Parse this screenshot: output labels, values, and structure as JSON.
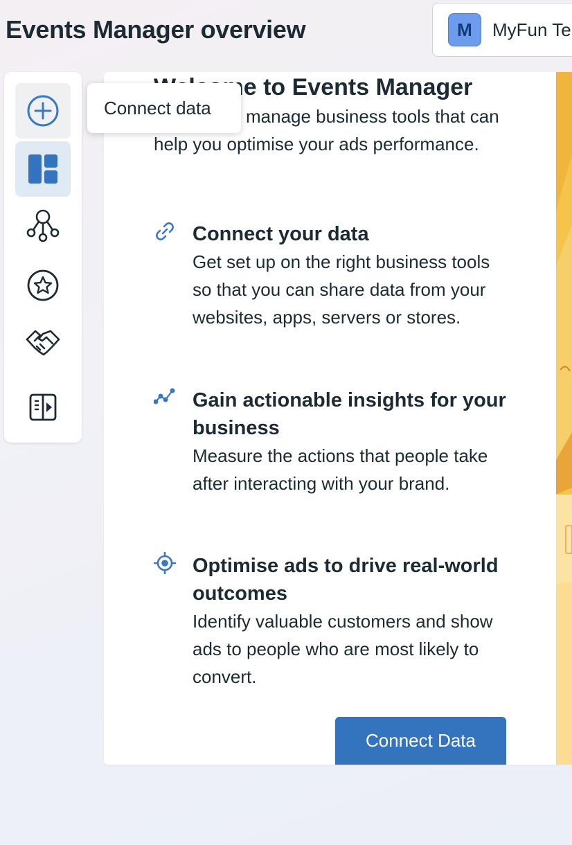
{
  "header": {
    "title": "Events Manager overview",
    "account": {
      "avatar_letter": "M",
      "name": "MyFun Te"
    }
  },
  "sidebar": {
    "items": [
      {
        "icon": "plus-circle-icon",
        "state": "hover"
      },
      {
        "icon": "dashboard-icon",
        "state": "active"
      },
      {
        "icon": "data-sources-icon",
        "state": "default"
      },
      {
        "icon": "star-badge-icon",
        "state": "default"
      },
      {
        "icon": "handshake-icon",
        "state": "default"
      },
      {
        "icon": "sidebar-toggle-icon",
        "state": "default"
      }
    ],
    "tooltip": "Connect data"
  },
  "welcome": {
    "title": "Welcome to Events Manager",
    "intro": "Set up and manage business tools that can help you optimise your ads performance.",
    "features": [
      {
        "icon": "link-icon",
        "heading": "Connect your data",
        "body": "Get set up on the right business tools so that you can share data from your websites, apps, servers or stores."
      },
      {
        "icon": "insights-icon",
        "heading": "Gain actionable insights for your business",
        "body": "Measure the actions that people take after interacting with your brand."
      },
      {
        "icon": "target-icon",
        "heading": "Optimise ads to drive real-world outcomes",
        "body": "Identify valuable customers and show ads to people who are most likely to convert."
      }
    ],
    "cta_label": "Connect Data"
  },
  "colors": {
    "primary": "#3474be",
    "icon_blue": "#3a78c3",
    "text": "#1c2b33",
    "art_yellow": "#f5b53a"
  }
}
